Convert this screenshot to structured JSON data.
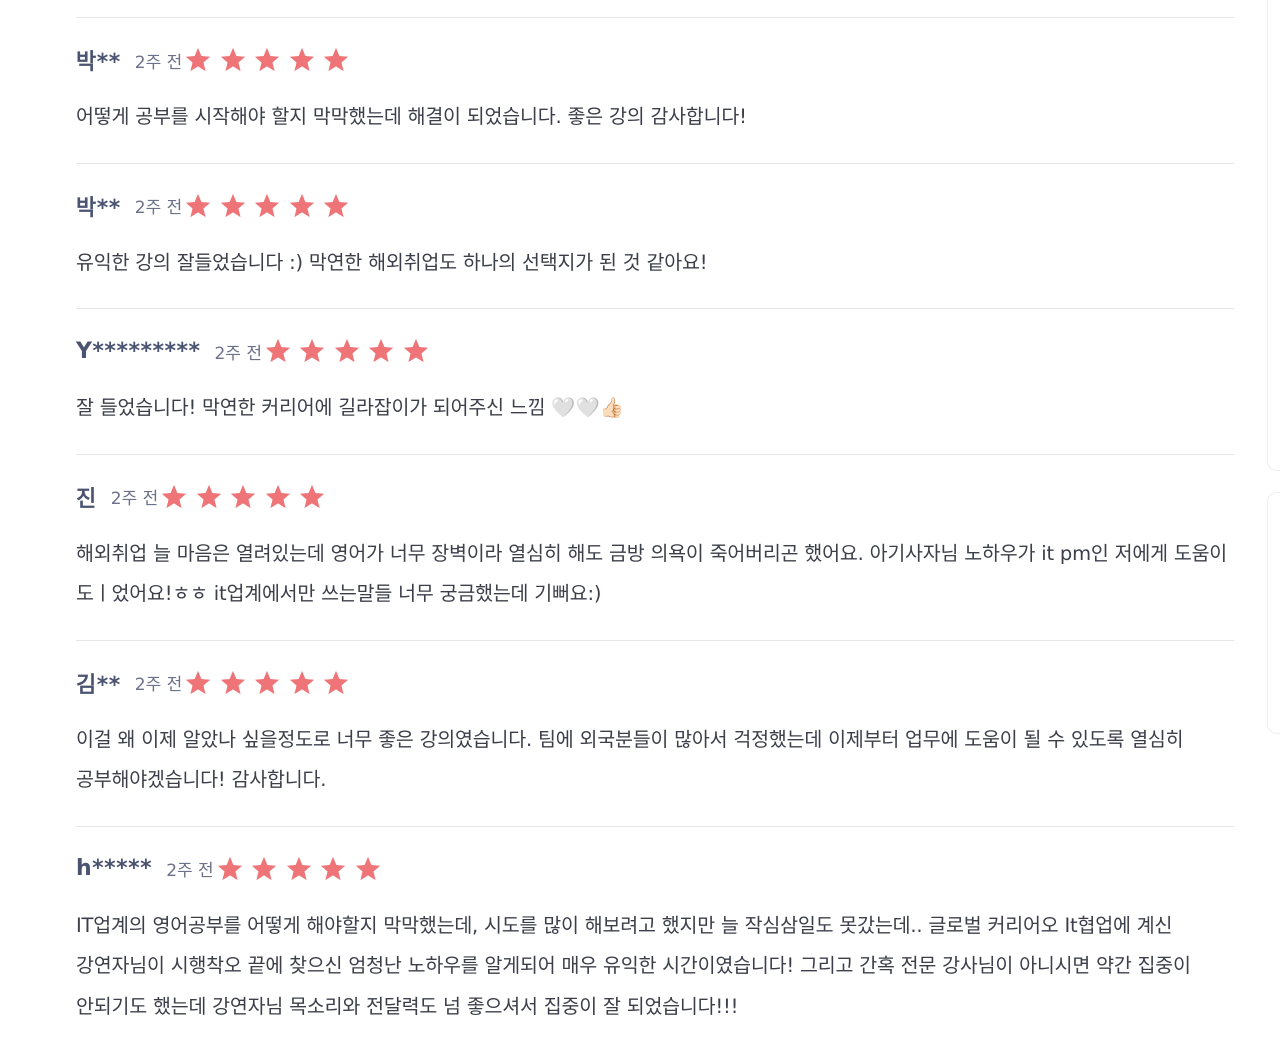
{
  "reviews": [
    {
      "author": "박**",
      "time": "2주 전",
      "rating": 5,
      "text": "어떻게 공부를 시작해야 할지 막막했는데 해결이 되었습니다. 좋은 강의 감사합니다!"
    },
    {
      "author": "박**",
      "time": "2주 전",
      "rating": 5,
      "text": "유익한 강의 잘들었습니다 :) 막연한 해외취업도 하나의 선택지가 된 것 같아요!"
    },
    {
      "author": "Y*********",
      "time": "2주 전",
      "rating": 5,
      "text": "잘 들었습니다! 막연한 커리어에 길라잡이가 되어주신 느낌 🤍🤍👍🏻"
    },
    {
      "author": "진",
      "time": "2주 전",
      "rating": 5,
      "text": "해외취업 늘 마음은 열려있는데 영어가 너무 장벽이라 열심히 해도 금방 의욕이 죽어버리곤 했어요. 아기사자님 노하우가 it pm인 저에게 도움이 도ㅣ었어요!ㅎㅎ it업계에서만 쓰는말들 너무 궁금했는데 기뻐요:)"
    },
    {
      "author": "김**",
      "time": "2주 전",
      "rating": 5,
      "text": "이걸 왜 이제 알았나 싶을정도로 너무 좋은 강의였습니다. 팀에 외국분들이 많아서 걱정했는데 이제부터 업무에 도움이 될 수 있도록 열심히 공부해야겠습니다! 감사합니다."
    },
    {
      "author": "h*****",
      "time": "2주 전",
      "rating": 5,
      "text": "IT업계의 영어공부를 어떻게 해야할지 막막했는데, 시도를 많이 해보려고 했지만 늘 작심삼일도 못갔는데.. 글로벌 커리어오 It협업에 계신 강연자님이 시행착오 끝에 찾으신 엄청난 노하우를 알게되어 매우 유익한 시간이였습니다! 그리고 간혹 전문 강사님이 아니시면 약간 집중이 안되기도 했는데 강연자님 목소리와 전달력도 넘 좋으셔서 집중이 잘 되었습니다!!!"
    }
  ],
  "icons": {
    "star": "star-icon"
  },
  "colors": {
    "star": "#ee7478",
    "author": "#4a5470",
    "text": "#3c3f4a",
    "divider": "#e6e6e6"
  }
}
